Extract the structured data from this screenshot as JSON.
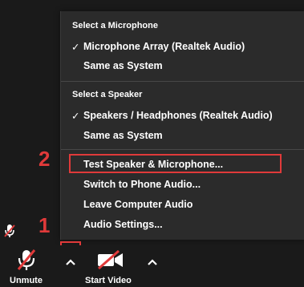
{
  "menu": {
    "microphone_heading": "Select a Microphone",
    "microphone_selected": "Microphone Array (Realtek Audio)",
    "microphone_same_as_system": "Same as System",
    "speaker_heading": "Select a Speaker",
    "speaker_selected": "Speakers / Headphones (Realtek Audio)",
    "speaker_same_as_system": "Same as System",
    "test_speaker_mic": "Test Speaker & Microphone...",
    "switch_phone_audio": "Switch to Phone Audio...",
    "leave_computer_audio": "Leave Computer Audio",
    "audio_settings": "Audio Settings...",
    "checkmark": "✓"
  },
  "annotations": {
    "step_1": "1",
    "step_2": "2",
    "highlight_color": "#e03a3a"
  },
  "toolbar": {
    "unmute_label": "Unmute",
    "start_video_label": "Start Video"
  },
  "colors": {
    "menu_bg": "#2b2b2b",
    "toolbar_bg": "#1a1a1a",
    "text": "#ffffff",
    "muted_slash": "#e03a3a"
  }
}
